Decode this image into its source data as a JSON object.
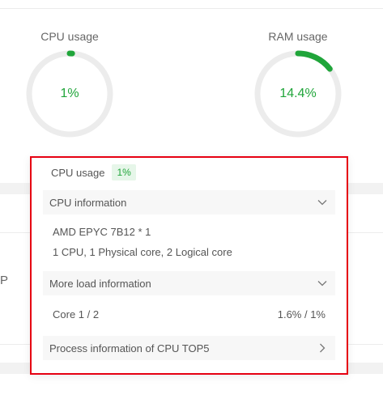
{
  "background": {
    "left_text": "P"
  },
  "gauges": {
    "cpu": {
      "title": "CPU usage",
      "value_text": "1%",
      "percent": 1
    },
    "ram": {
      "title": "RAM usage",
      "value_text": "14.4%",
      "percent": 14.4
    }
  },
  "popover": {
    "usage_label": "CPU usage",
    "usage_badge": "1%",
    "cpu_info": {
      "header": "CPU information",
      "model": "AMD EPYC 7B12 * 1",
      "cores": "1 CPU, 1 Physical core, 2 Logical core"
    },
    "load_info": {
      "header": "More load information",
      "core_label": "Core 1 / 2",
      "core_value": "1.6% / 1%"
    },
    "top5": {
      "header": "Process information of CPU TOP5"
    }
  },
  "colors": {
    "accent": "#20a53a",
    "ring_bg": "#ececec",
    "highlight_border": "#e60012"
  },
  "icons": {
    "cpu_info_toggle": "chevron-down-icon",
    "load_info_toggle": "chevron-down-icon",
    "top5_toggle": "chevron-right-icon"
  }
}
